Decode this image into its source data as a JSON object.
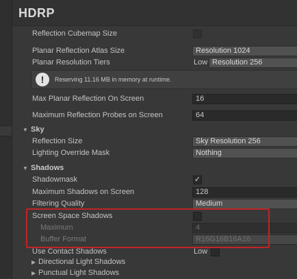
{
  "title": "HDRP",
  "reflection_cubemap_size": {
    "label": "Reflection Cubemap Size"
  },
  "planar_atlas_size": {
    "label": "Planar Reflection Atlas Size",
    "value": "Resolution 1024"
  },
  "planar_tiers": {
    "label": "Planar Resolution Tiers",
    "tier": "Low",
    "value": "Resolution 256"
  },
  "info": {
    "icon": "warning-icon",
    "message": "Reserving 11.16 MB in memory at runtime."
  },
  "max_planar": {
    "label": "Max Planar Reflection On Screen",
    "value": "16"
  },
  "max_probes": {
    "label": "Maximum Reflection Probes on Screen",
    "value": "64"
  },
  "sky": {
    "section": "Sky",
    "reflection_size": {
      "label": "Reflection Size",
      "value": "Sky Resolution 256"
    },
    "override_mask": {
      "label": "Lighting Override Mask",
      "value": "Nothing"
    }
  },
  "shadows": {
    "section": "Shadows",
    "shadowmask": {
      "label": "Shadowmask",
      "checked": "✓"
    },
    "max_shadows": {
      "label": "Maximum Shadows on Screen",
      "value": "128"
    },
    "filtering": {
      "label": "Filtering Quality",
      "value": "Medium"
    },
    "screen_space": {
      "label": "Screen Space Shadows"
    },
    "maximum": {
      "label": "Maximum",
      "value": "4"
    },
    "buffer_format": {
      "label": "Buffer Format",
      "value": "R16G16B16A16"
    },
    "contact": {
      "label": "Use Contact Shadows",
      "tier": "Low"
    },
    "directional": {
      "label": "Directional Light Shadows"
    },
    "punctual": {
      "label": "Punctual Light Shadows"
    }
  },
  "colors": {
    "highlight": "#c22425",
    "background": "#383838"
  }
}
